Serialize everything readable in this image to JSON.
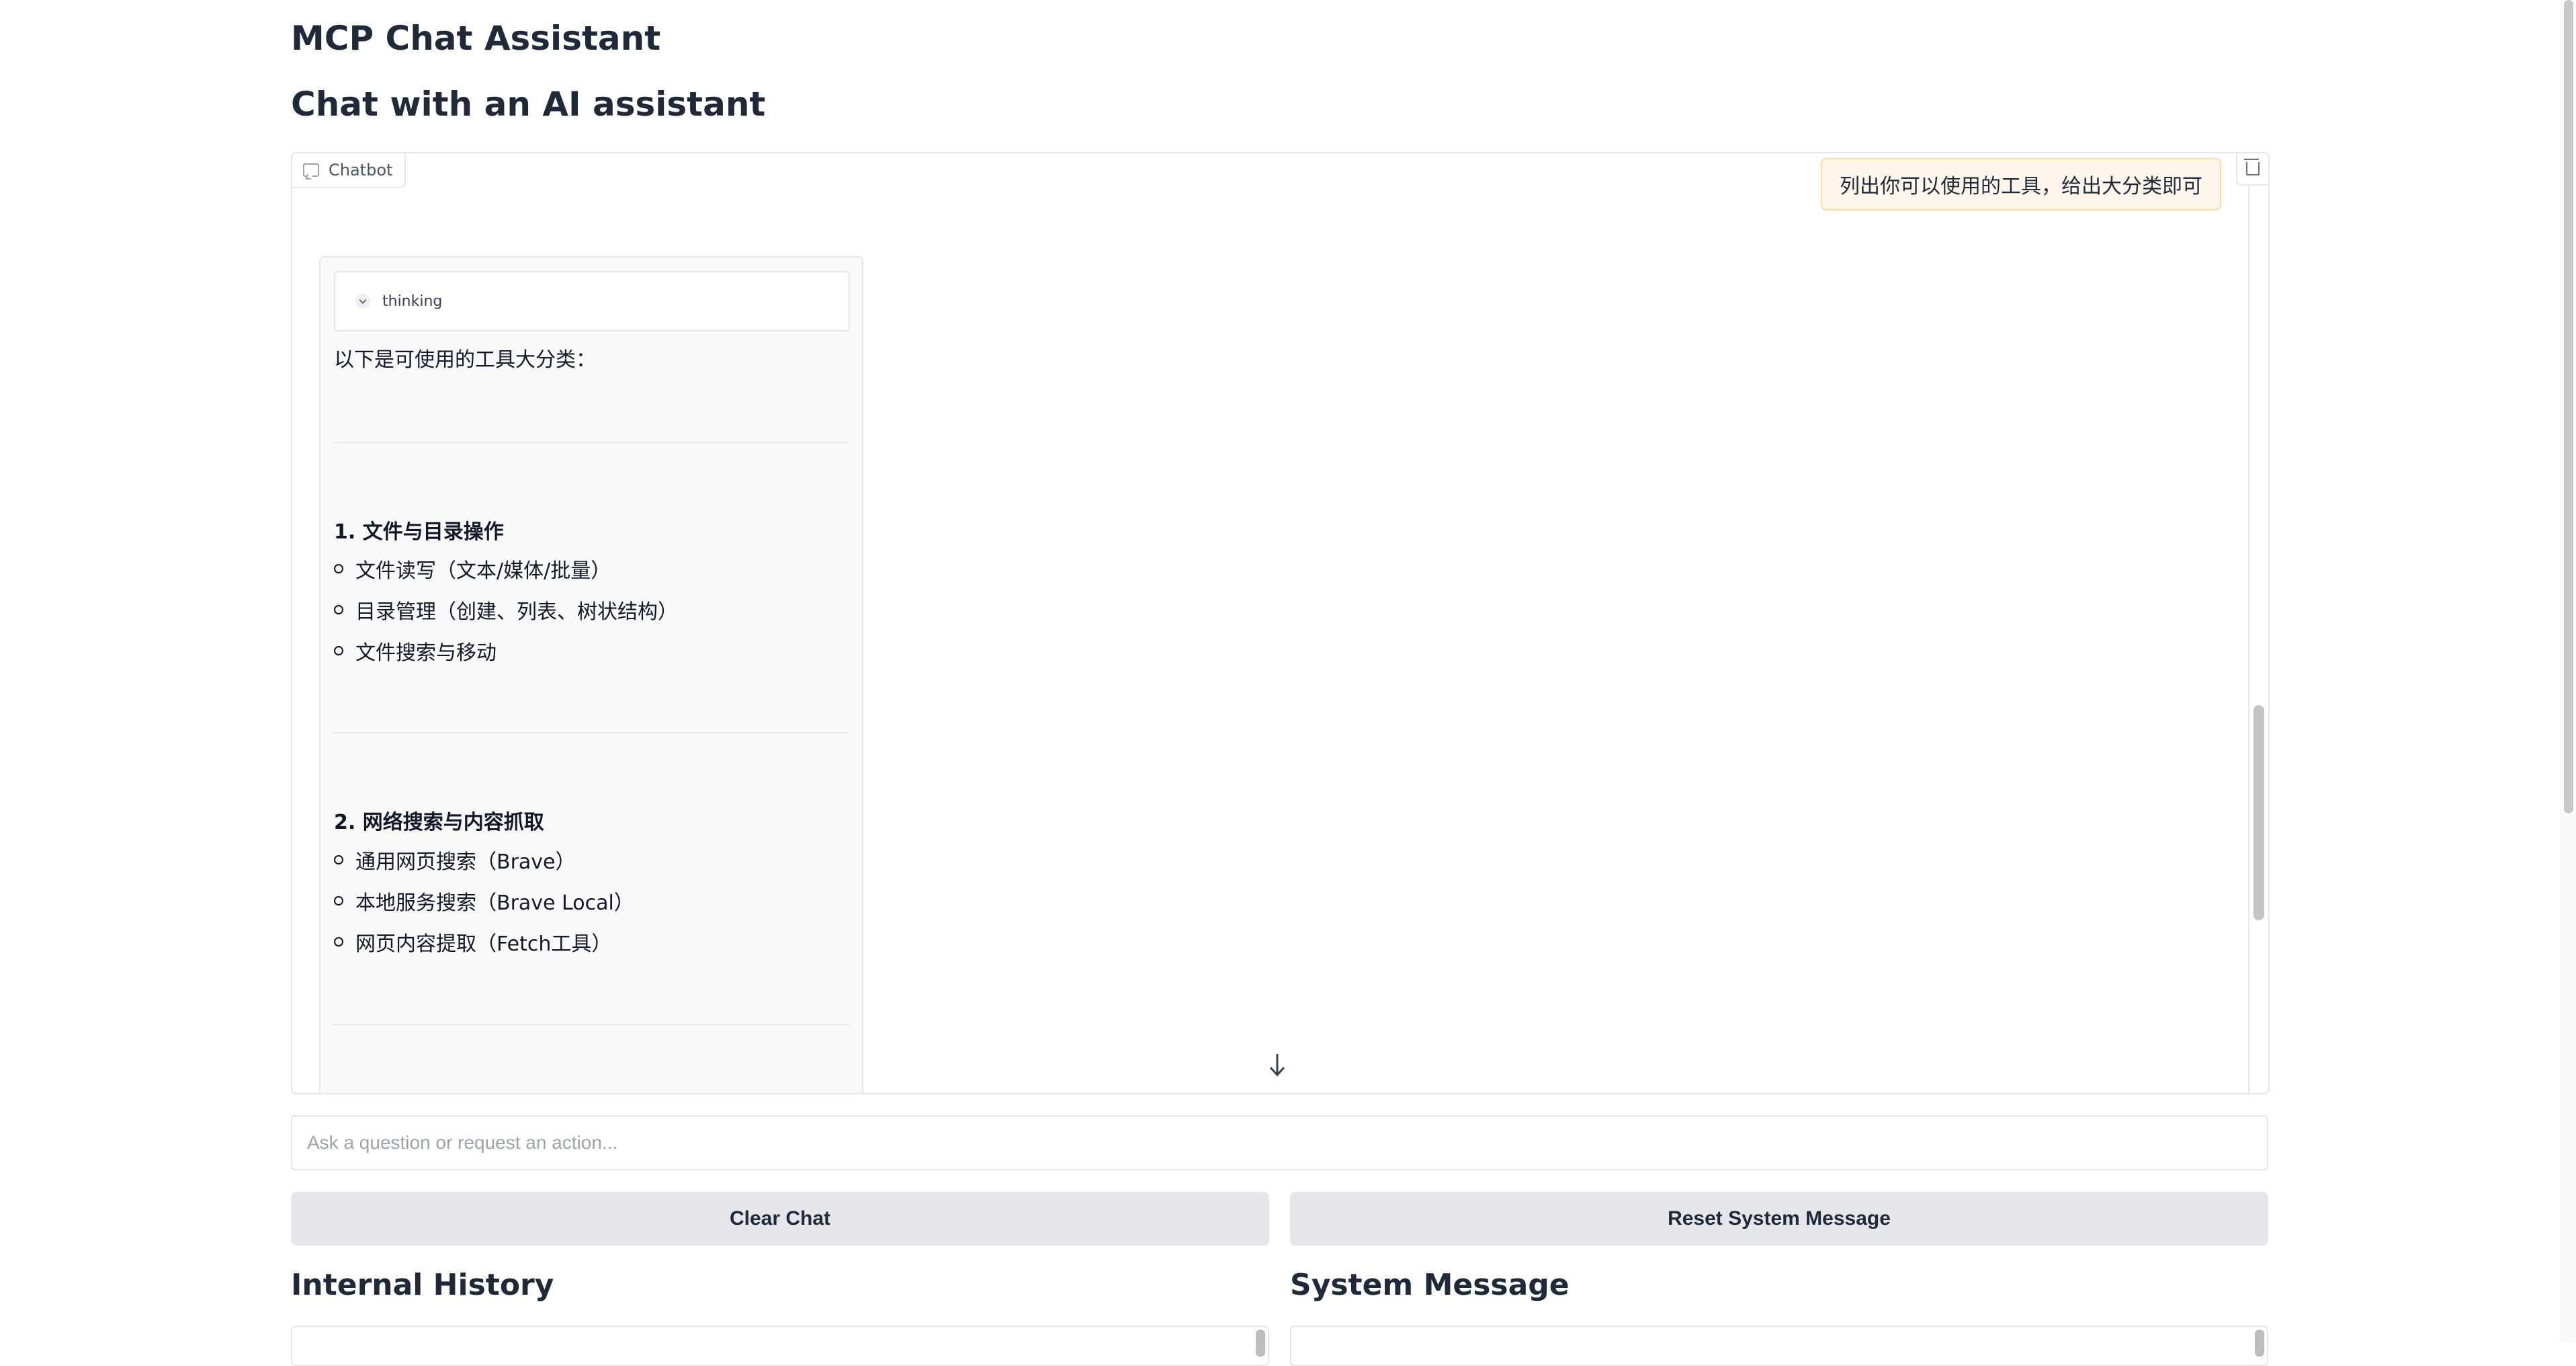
{
  "app": {
    "title": "MCP Chat Assistant",
    "subtitle": "Chat with an AI assistant"
  },
  "chatbot": {
    "label": "Chatbot",
    "label_icon": "chat-icon",
    "clear_icon": "trash-icon",
    "scroll_down_icon": "arrow-down-icon",
    "messages": {
      "user": "列出你可以使用的工具，给出大分类即可",
      "assistant": {
        "thinking_label": "thinking",
        "intro": "以下是可使用的工具大分类：",
        "sections": [
          {
            "title": "1. 文件与目录操作",
            "items": [
              "文件读写（文本/媒体/批量）",
              "目录管理（创建、列表、树状结构）",
              "文件搜索与移动"
            ]
          },
          {
            "title": "2. 网络搜索与内容抓取",
            "items": [
              "通用网页搜索（Brave）",
              "本地服务搜索（Brave Local）",
              "网页内容提取（Fetch工具）"
            ]
          }
        ]
      }
    }
  },
  "input": {
    "placeholder": "Ask a question or request an action...",
    "value": ""
  },
  "buttons": {
    "clear_chat": "Clear Chat",
    "reset_system": "Reset System Message"
  },
  "panels": {
    "internal_history": "Internal History",
    "system_message": "System Message"
  },
  "colors": {
    "user_bubble_bg": "#fff7ed",
    "user_bubble_border": "#fcd9a8",
    "button_bg": "#e5e7eb"
  }
}
